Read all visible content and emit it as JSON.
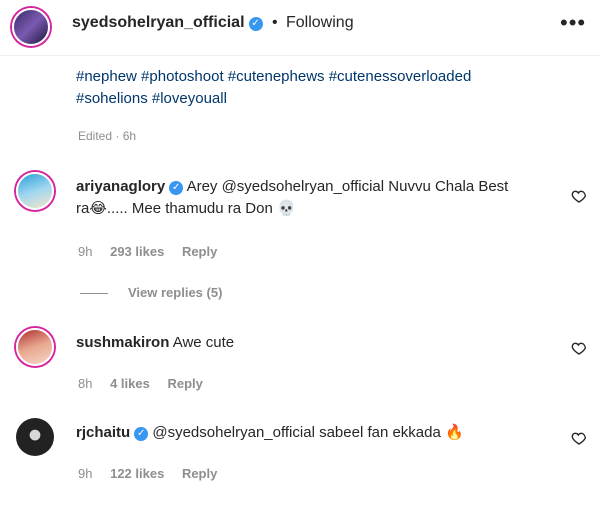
{
  "header": {
    "username": "syedsohelryan_official",
    "separator": "•",
    "follow_status": "Following",
    "more_label": "•••"
  },
  "caption": {
    "hashtags_line1": "#nephew #photoshoot #cutenephews #cutenessoverloaded",
    "hashtags_line2": "#sohelions #loveyouall",
    "edited": "Edited · 6h"
  },
  "comments": [
    {
      "username": "ariyanaglory",
      "text_mention": "Arey @syedsohelryan_official",
      "text_rest1": " Nuvvu Chala Best",
      "text_line2": "ra",
      "text_line2_rest": "..... Mee thamudu ra Don",
      "time": "9h",
      "likes": "293 likes",
      "reply": "Reply"
    },
    {
      "username": "sushmakiron",
      "text": "Awe cute",
      "time": "8h",
      "likes": "4 likes",
      "reply": "Reply"
    },
    {
      "username": "rjchaitu",
      "text_mention": "@syedsohelryan_official",
      "text_rest": " sabeel fan ekkada",
      "time": "9h",
      "likes": "122 likes",
      "reply": "Reply"
    }
  ],
  "view_replies": "View replies (5)",
  "colors": {
    "link": "#00376b",
    "muted": "#8e8e8e",
    "verified": "#3897f0",
    "story_ring": "#d6249f"
  }
}
